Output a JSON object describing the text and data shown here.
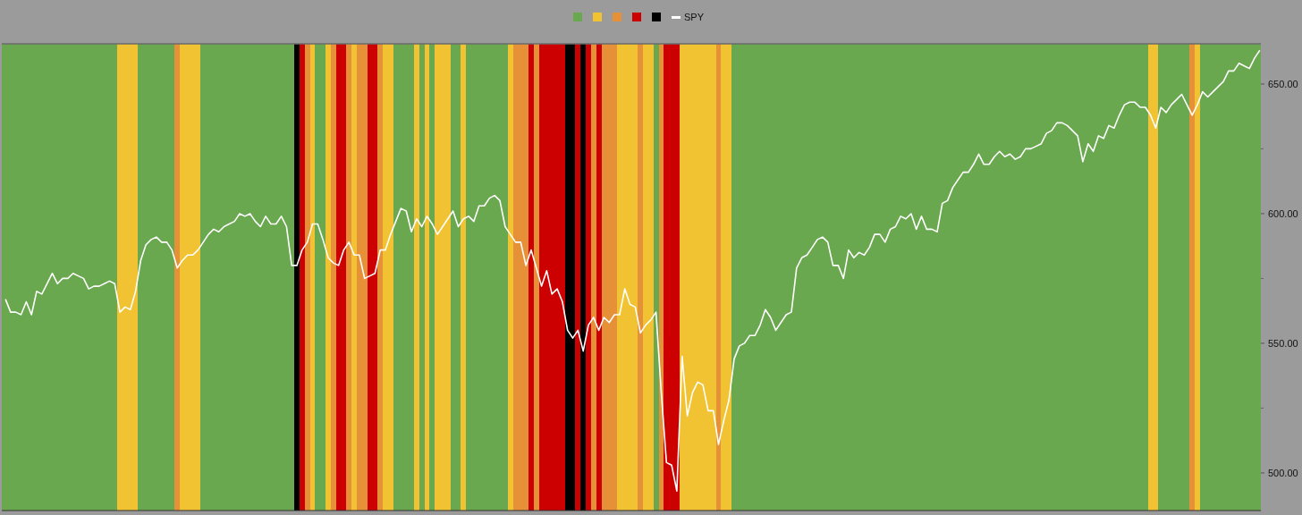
{
  "chart": {
    "legend": [
      {
        "color": "#6aa84f"
      },
      {
        "color": "#f1c232"
      },
      {
        "color": "#e69138"
      },
      {
        "color": "#cc0000"
      },
      {
        "color": "#000000"
      }
    ],
    "regimes": [
      {
        "color": "#6aa84f"
      },
      {
        "color": "#6aa84f"
      },
      {
        "color": "#6aa84f"
      },
      {
        "color": "#6aa84f"
      },
      {
        "color": "#6aa84f"
      },
      {
        "color": "#6aa84f"
      },
      {
        "color": "#6aa84f"
      },
      {
        "color": "#6aa84f"
      },
      {
        "color": "#6aa84f"
      },
      {
        "color": "#6aa84f"
      },
      {
        "color": "#6aa84f"
      },
      {
        "color": "#6aa84f"
      },
      {
        "color": "#6aa84f"
      },
      {
        "color": "#6aa84f"
      },
      {
        "color": "#6aa84f"
      },
      {
        "color": "#6aa84f"
      },
      {
        "color": "#6aa84f"
      },
      {
        "color": "#6aa84f"
      },
      {
        "color": "#6aa84f"
      },
      {
        "color": "#6aa84f"
      },
      {
        "color": "#6aa84f"
      },
      {
        "color": "#6aa84f"
      },
      {
        "color": "#f1c232"
      },
      {
        "color": "#f1c232"
      },
      {
        "color": "#f1c232"
      },
      {
        "color": "#f1c232"
      },
      {
        "color": "#6aa84f"
      },
      {
        "color": "#6aa84f"
      },
      {
        "color": "#6aa84f"
      },
      {
        "color": "#6aa84f"
      },
      {
        "color": "#6aa84f"
      },
      {
        "color": "#6aa84f"
      },
      {
        "color": "#6aa84f"
      },
      {
        "color": "#e69138"
      },
      {
        "color": "#f1c232"
      },
      {
        "color": "#f1c232"
      },
      {
        "color": "#f1c232"
      },
      {
        "color": "#f1c232"
      },
      {
        "color": "#6aa84f"
      },
      {
        "color": "#6aa84f"
      },
      {
        "color": "#6aa84f"
      },
      {
        "color": "#6aa84f"
      },
      {
        "color": "#6aa84f"
      },
      {
        "color": "#6aa84f"
      },
      {
        "color": "#6aa84f"
      },
      {
        "color": "#6aa84f"
      },
      {
        "color": "#6aa84f"
      },
      {
        "color": "#6aa84f"
      },
      {
        "color": "#6aa84f"
      },
      {
        "color": "#6aa84f"
      },
      {
        "color": "#6aa84f"
      },
      {
        "color": "#6aa84f"
      },
      {
        "color": "#6aa84f"
      },
      {
        "color": "#6aa84f"
      },
      {
        "color": "#6aa84f"
      },
      {
        "color": "#6aa84f"
      },
      {
        "color": "#000000"
      },
      {
        "color": "#cc0000"
      },
      {
        "color": "#e69138"
      },
      {
        "color": "#f1c232"
      },
      {
        "color": "#6aa84f"
      },
      {
        "color": "#6aa84f"
      },
      {
        "color": "#f1c232"
      },
      {
        "color": "#e69138"
      },
      {
        "color": "#cc0000"
      },
      {
        "color": "#cc0000"
      },
      {
        "color": "#e69138"
      },
      {
        "color": "#f1c232"
      },
      {
        "color": "#e69138"
      },
      {
        "color": "#e69138"
      },
      {
        "color": "#cc0000"
      },
      {
        "color": "#cc0000"
      },
      {
        "color": "#e69138"
      },
      {
        "color": "#f1c232"
      },
      {
        "color": "#f1c232"
      },
      {
        "color": "#6aa84f"
      },
      {
        "color": "#6aa84f"
      },
      {
        "color": "#6aa84f"
      },
      {
        "color": "#6aa84f"
      },
      {
        "color": "#f1c232"
      },
      {
        "color": "#6aa84f"
      },
      {
        "color": "#f1c232"
      },
      {
        "color": "#6aa84f"
      },
      {
        "color": "#f1c232"
      },
      {
        "color": "#f1c232"
      },
      {
        "color": "#f1c232"
      },
      {
        "color": "#6aa84f"
      },
      {
        "color": "#6aa84f"
      },
      {
        "color": "#f1c232"
      },
      {
        "color": "#6aa84f"
      },
      {
        "color": "#6aa84f"
      },
      {
        "color": "#6aa84f"
      },
      {
        "color": "#6aa84f"
      },
      {
        "color": "#6aa84f"
      },
      {
        "color": "#6aa84f"
      },
      {
        "color": "#6aa84f"
      },
      {
        "color": "#6aa84f"
      },
      {
        "color": "#f1c232"
      },
      {
        "color": "#e69138"
      },
      {
        "color": "#e69138"
      },
      {
        "color": "#e69138"
      },
      {
        "color": "#cc0000"
      },
      {
        "color": "#e69138"
      },
      {
        "color": "#cc0000"
      },
      {
        "color": "#cc0000"
      },
      {
        "color": "#cc0000"
      },
      {
        "color": "#cc0000"
      },
      {
        "color": "#cc0000"
      },
      {
        "color": "#000000"
      },
      {
        "color": "#000000"
      },
      {
        "color": "#cc0000"
      },
      {
        "color": "#000000"
      },
      {
        "color": "#cc0000"
      },
      {
        "color": "#e69138"
      },
      {
        "color": "#cc0000"
      },
      {
        "color": "#e69138"
      },
      {
        "color": "#e69138"
      },
      {
        "color": "#e69138"
      },
      {
        "color": "#f1c232"
      },
      {
        "color": "#f1c232"
      },
      {
        "color": "#f1c232"
      },
      {
        "color": "#f1c232"
      },
      {
        "color": "#e69138"
      },
      {
        "color": "#f1c232"
      },
      {
        "color": "#f1c232"
      },
      {
        "color": "#6aa84f"
      },
      {
        "color": "#e69138"
      },
      {
        "color": "#cc0000"
      },
      {
        "color": "#cc0000"
      },
      {
        "color": "#cc0000"
      },
      {
        "color": "#f1c232"
      },
      {
        "color": "#f1c232"
      },
      {
        "color": "#f1c232"
      },
      {
        "color": "#f1c232"
      },
      {
        "color": "#f1c232"
      },
      {
        "color": "#f1c232"
      },
      {
        "color": "#f1c232"
      },
      {
        "color": "#e69138"
      },
      {
        "color": "#f1c232"
      },
      {
        "color": "#f1c232"
      },
      {
        "color": "#6aa84f"
      },
      {
        "color": "#6aa84f"
      },
      {
        "color": "#6aa84f"
      },
      {
        "color": "#6aa84f"
      },
      {
        "color": "#6aa84f"
      },
      {
        "color": "#6aa84f"
      },
      {
        "color": "#6aa84f"
      },
      {
        "color": "#6aa84f"
      },
      {
        "color": "#6aa84f"
      },
      {
        "color": "#6aa84f"
      },
      {
        "color": "#6aa84f"
      },
      {
        "color": "#6aa84f"
      },
      {
        "color": "#6aa84f"
      },
      {
        "color": "#6aa84f"
      },
      {
        "color": "#6aa84f"
      },
      {
        "color": "#6aa84f"
      },
      {
        "color": "#6aa84f"
      },
      {
        "color": "#6aa84f"
      },
      {
        "color": "#6aa84f"
      },
      {
        "color": "#6aa84f"
      },
      {
        "color": "#6aa84f"
      },
      {
        "color": "#6aa84f"
      },
      {
        "color": "#6aa84f"
      },
      {
        "color": "#6aa84f"
      },
      {
        "color": "#6aa84f"
      },
      {
        "color": "#6aa84f"
      },
      {
        "color": "#6aa84f"
      },
      {
        "color": "#6aa84f"
      },
      {
        "color": "#6aa84f"
      },
      {
        "color": "#6aa84f"
      },
      {
        "color": "#6aa84f"
      },
      {
        "color": "#6aa84f"
      },
      {
        "color": "#6aa84f"
      },
      {
        "color": "#6aa84f"
      },
      {
        "color": "#6aa84f"
      },
      {
        "color": "#6aa84f"
      },
      {
        "color": "#6aa84f"
      },
      {
        "color": "#6aa84f"
      },
      {
        "color": "#6aa84f"
      },
      {
        "color": "#6aa84f"
      },
      {
        "color": "#6aa84f"
      },
      {
        "color": "#6aa84f"
      },
      {
        "color": "#6aa84f"
      },
      {
        "color": "#6aa84f"
      },
      {
        "color": "#6aa84f"
      },
      {
        "color": "#6aa84f"
      },
      {
        "color": "#6aa84f"
      },
      {
        "color": "#6aa84f"
      },
      {
        "color": "#6aa84f"
      },
      {
        "color": "#6aa84f"
      },
      {
        "color": "#6aa84f"
      },
      {
        "color": "#6aa84f"
      },
      {
        "color": "#6aa84f"
      },
      {
        "color": "#6aa84f"
      },
      {
        "color": "#6aa84f"
      },
      {
        "color": "#6aa84f"
      },
      {
        "color": "#6aa84f"
      },
      {
        "color": "#6aa84f"
      },
      {
        "color": "#6aa84f"
      },
      {
        "color": "#6aa84f"
      },
      {
        "color": "#6aa84f"
      },
      {
        "color": "#6aa84f"
      },
      {
        "color": "#6aa84f"
      },
      {
        "color": "#6aa84f"
      },
      {
        "color": "#6aa84f"
      },
      {
        "color": "#6aa84f"
      },
      {
        "color": "#6aa84f"
      },
      {
        "color": "#6aa84f"
      },
      {
        "color": "#6aa84f"
      },
      {
        "color": "#6aa84f"
      },
      {
        "color": "#6aa84f"
      },
      {
        "color": "#6aa84f"
      },
      {
        "color": "#6aa84f"
      },
      {
        "color": "#6aa84f"
      },
      {
        "color": "#6aa84f"
      },
      {
        "color": "#6aa84f"
      },
      {
        "color": "#6aa84f"
      },
      {
        "color": "#6aa84f"
      },
      {
        "color": "#6aa84f"
      },
      {
        "color": "#6aa84f"
      },
      {
        "color": "#f1c232"
      },
      {
        "color": "#f1c232"
      },
      {
        "color": "#6aa84f"
      },
      {
        "color": "#6aa84f"
      },
      {
        "color": "#6aa84f"
      },
      {
        "color": "#6aa84f"
      },
      {
        "color": "#6aa84f"
      },
      {
        "color": "#6aa84f"
      },
      {
        "color": "#e69138"
      },
      {
        "color": "#f1c232"
      },
      {
        "color": "#6aa84f"
      },
      {
        "color": "#6aa84f"
      },
      {
        "color": "#6aa84f"
      },
      {
        "color": "#6aa84f"
      },
      {
        "color": "#6aa84f"
      },
      {
        "color": "#6aa84f"
      },
      {
        "color": "#6aa84f"
      },
      {
        "color": "#6aa84f"
      },
      {
        "color": "#6aa84f"
      },
      {
        "color": "#6aa84f"
      },
      {
        "color": "#6aa84f"
      },
      {
        "color": "#6aa84f"
      }
    ],
    "chart_data": {
      "type": "line",
      "ylim": [
        485.5,
        665.5
      ],
      "yticks": [
        {
          "value": 500,
          "label": "500.00"
        },
        {
          "value": 550,
          "label": "550.00"
        },
        {
          "value": 600,
          "label": "600.00"
        },
        {
          "value": 650,
          "label": "650.00"
        }
      ],
      "series": [
        {
          "name": "SPY",
          "color": "#ffffff",
          "values": [
            567,
            562,
            562,
            561,
            566,
            561,
            570,
            569,
            573,
            577,
            573,
            575,
            575,
            577,
            576,
            575,
            571,
            572,
            572,
            573,
            574,
            573,
            562,
            564,
            563,
            570,
            582,
            588,
            590,
            591,
            589,
            589,
            586,
            579,
            582,
            584,
            584,
            586,
            589,
            592,
            594,
            593,
            595,
            596,
            597,
            600,
            599,
            600,
            597,
            595,
            599,
            596,
            596,
            599,
            595,
            580,
            580,
            586,
            589,
            596,
            596,
            590,
            583,
            581,
            580,
            586,
            589,
            584,
            584,
            575,
            576,
            577,
            586,
            586,
            592,
            597,
            602,
            601,
            593,
            598,
            595,
            599,
            596,
            592,
            595,
            598,
            601,
            595,
            598,
            599,
            597,
            603,
            603,
            606,
            607,
            605,
            595,
            592,
            589,
            589,
            580,
            586,
            579,
            572,
            578,
            569,
            571,
            566,
            555,
            552,
            555,
            547,
            557,
            560,
            555,
            560,
            558,
            561,
            561,
            571,
            565,
            564,
            554,
            557,
            559,
            562,
            531,
            504,
            503,
            493,
            545,
            522,
            531,
            535,
            534,
            524,
            524,
            511,
            520,
            528,
            544,
            549,
            550,
            553,
            553,
            557,
            563,
            560,
            555,
            558,
            561,
            562,
            579,
            583,
            584,
            587,
            590,
            591,
            589,
            580,
            580,
            575,
            586,
            583,
            585,
            584,
            587,
            592,
            592,
            589,
            594,
            595,
            599,
            598,
            600,
            594,
            599,
            594,
            594,
            593,
            604,
            605,
            610,
            613,
            616,
            616,
            619,
            623,
            619,
            619,
            622,
            624,
            622,
            623,
            621,
            622,
            625,
            625,
            626,
            627,
            631,
            632,
            635,
            635,
            634,
            632,
            630,
            620,
            627,
            624,
            630,
            629,
            634,
            633,
            638,
            642,
            643,
            643,
            641,
            641,
            638,
            633,
            641,
            639,
            642,
            644,
            646,
            642,
            638,
            642,
            647,
            645,
            647,
            649,
            651,
            655,
            655,
            658,
            657,
            656,
            660,
            663
          ]
        }
      ]
    }
  }
}
